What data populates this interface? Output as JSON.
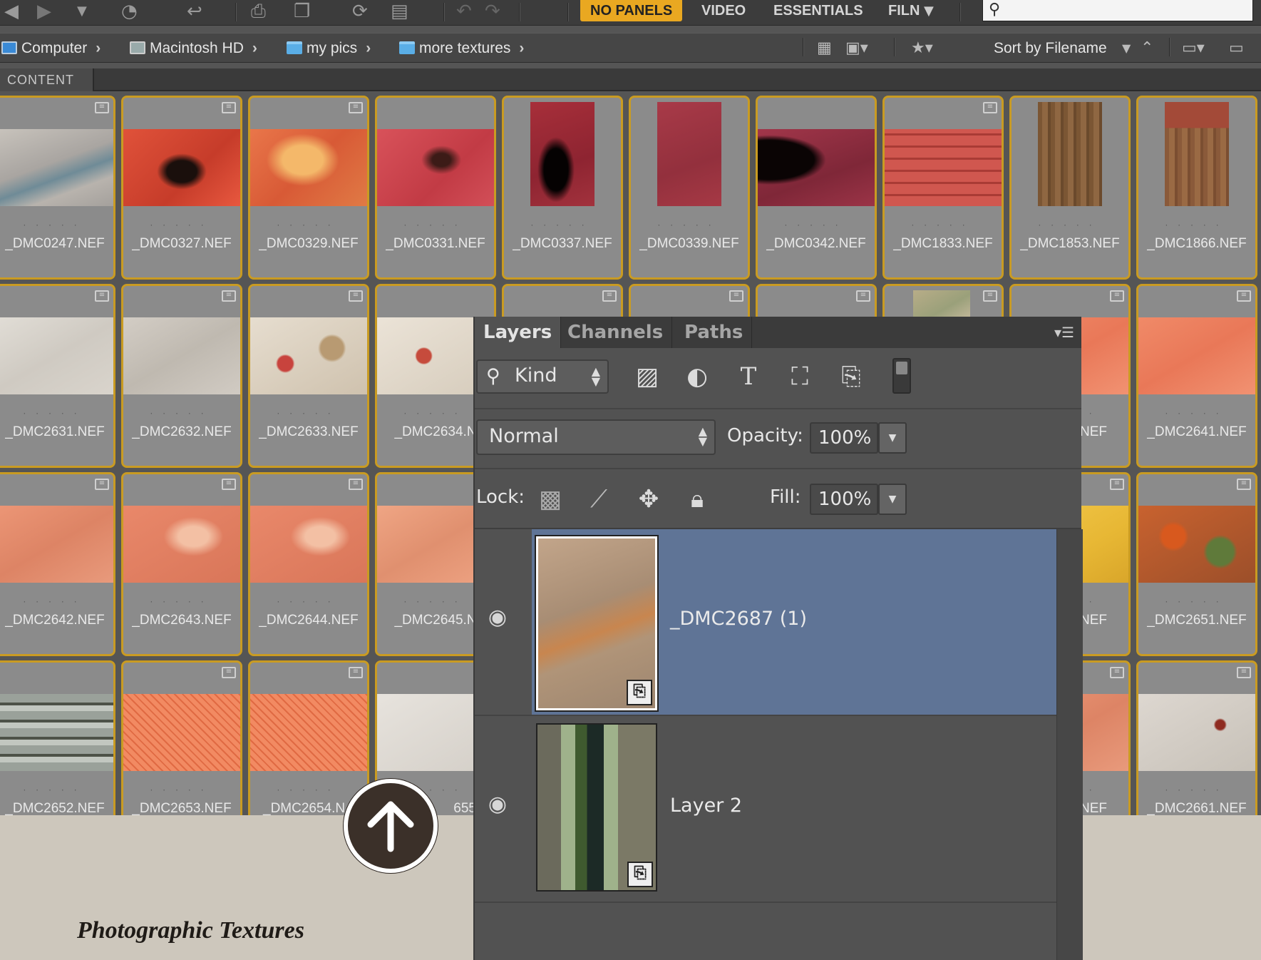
{
  "toolbar": {
    "workspaces": [
      "NO PANELS",
      "VIDEO",
      "ESSENTIALS",
      "FILN"
    ],
    "active_workspace": "NO PANELS",
    "search_placeholder": ""
  },
  "breadcrumb": [
    {
      "label": "Computer",
      "icon": "computer-icon"
    },
    {
      "label": "Macintosh HD",
      "icon": "hard-drive-icon"
    },
    {
      "label": "my pics",
      "icon": "folder-icon"
    },
    {
      "label": "more textures",
      "icon": "folder-icon"
    }
  ],
  "pathbar": {
    "sort_label": "Sort by Filename"
  },
  "content_tab": "CONTENT",
  "grid_rows": [
    [
      "_DMC0247.NEF",
      "_DMC0327.NEF",
      "_DMC0329.NEF",
      "_DMC0331.NEF",
      "_DMC0337.NEF",
      "_DMC0339.NEF",
      "_DMC0342.NEF",
      "_DMC1833.NEF",
      "_DMC1853.NEF",
      "_DMC1866.NEF"
    ],
    [
      "_DMC2631.NEF",
      "_DMC2632.NEF",
      "_DMC2633.NEF",
      "_DMC2634.N",
      "",
      "",
      "",
      "",
      "0.NEF",
      "_DMC2641.NEF"
    ],
    [
      "_DMC2642.NEF",
      "_DMC2643.NEF",
      "_DMC2644.NEF",
      "_DMC2645.N",
      "",
      "",
      "",
      "",
      "0.NEF",
      "_DMC2651.NEF"
    ],
    [
      "_DMC2652.NEF",
      "_DMC2653.NEF",
      "_DMC2654.N",
      "655.N",
      "",
      "",
      "",
      "",
      "0.NEF",
      "_DMC2661.NEF"
    ]
  ],
  "layers_panel": {
    "tabs": [
      "Layers",
      "Channels",
      "Paths"
    ],
    "active_tab": "Layers",
    "filter_kind": "Kind",
    "blend_mode": "Normal",
    "opacity_label": "Opacity:",
    "opacity_value": "100%",
    "lock_label": "Lock:",
    "fill_label": "Fill:",
    "fill_value": "100%",
    "layers": [
      {
        "name": "_DMC2687 (1)",
        "selected": true
      },
      {
        "name": "Layer 2",
        "selected": false
      }
    ]
  },
  "caption": "Photographic Textures",
  "colors": {
    "accent": "#e9a821",
    "selected_layer": "#5f7496",
    "page_background": "#cdc7bc"
  }
}
